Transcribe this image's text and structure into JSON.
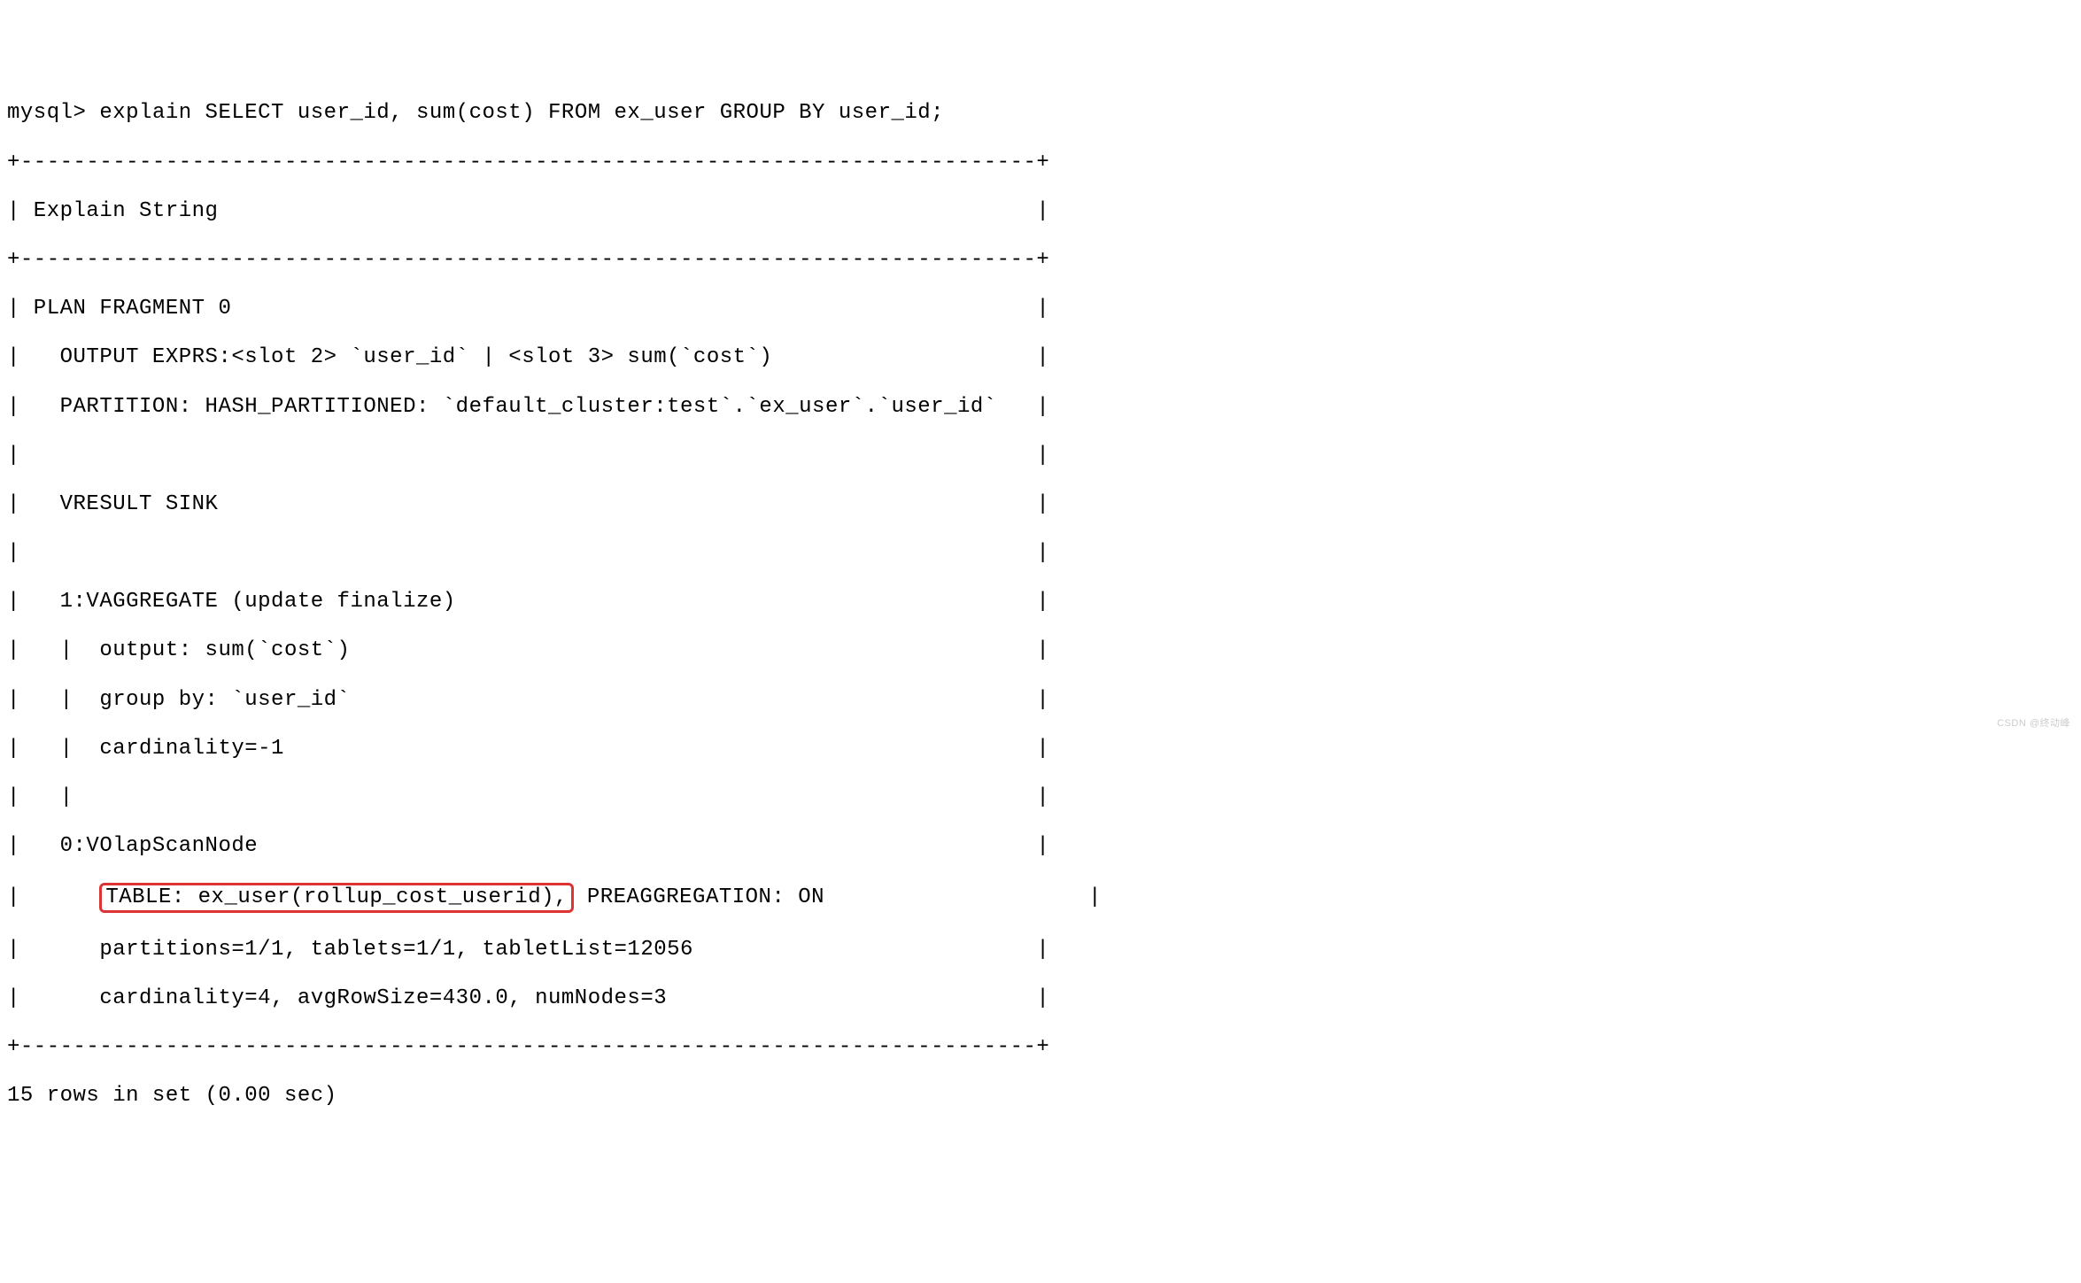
{
  "terminal": {
    "prompt": "mysql> ",
    "command": "explain SELECT user_id, sum(cost) FROM ex_user GROUP BY user_id;",
    "border_top": "+-----------------------------------------------------------------------------+",
    "header_line": "| Explain String                                                              |",
    "border_mid": "+-----------------------------------------------------------------------------+",
    "plan_line1": "| PLAN FRAGMENT 0                                                             |",
    "plan_line2": "|   OUTPUT EXPRS:<slot 2> `user_id` | <slot 3> sum(`cost`)                    |",
    "plan_line3": "|   PARTITION: HASH_PARTITIONED: `default_cluster:test`.`ex_user`.`user_id`   |",
    "plan_line4": "|                                                                             |",
    "plan_line5": "|   VRESULT SINK                                                              |",
    "plan_line6": "|                                                                             |",
    "plan_line7": "|   1:VAGGREGATE (update finalize)                                            |",
    "plan_line8": "|   |  output: sum(`cost`)                                                    |",
    "plan_line9": "|   |  group by: `user_id`                                                    |",
    "plan_line10": "|   |  cardinality=-1                                                         |",
    "plan_line11": "|   |                                                                         |",
    "plan_line12": "|   0:VOlapScanNode                                                           |",
    "plan_line13_prefix": "|      ",
    "plan_line13_highlight": "TABLE: ex_user(rollup_cost_userid),",
    "plan_line13_suffix": " PREAGGREGATION: ON                    |",
    "plan_line14": "|      partitions=1/1, tablets=1/1, tabletList=12056                          |",
    "plan_line15": "|      cardinality=4, avgRowSize=430.0, numNodes=3                            |",
    "border_bottom": "+-----------------------------------------------------------------------------+",
    "result_status": "15 rows in set (0.00 sec)"
  },
  "watermark": "CSDN @终动峰"
}
